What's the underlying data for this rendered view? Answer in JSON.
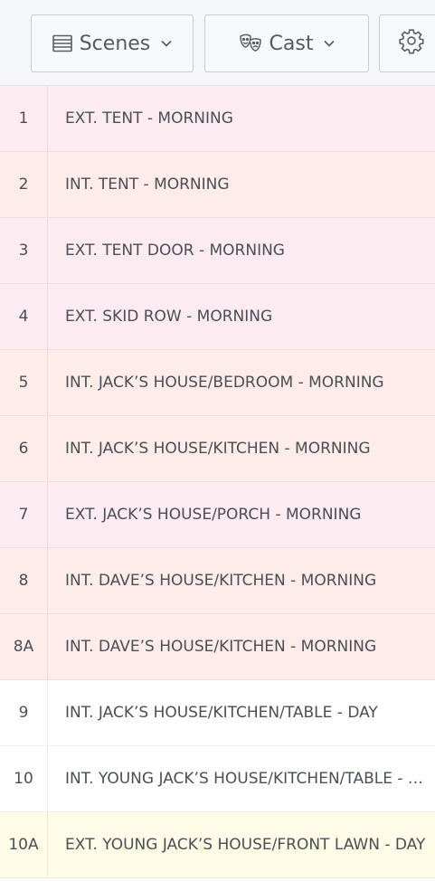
{
  "toolbar": {
    "scenes_label": "Scenes",
    "cast_label": "Cast",
    "icons": {
      "scenes": "list-icon",
      "cast": "masks-icon",
      "settings": "gear-icon",
      "dropdown": "chevron-down-icon"
    }
  },
  "colors": {
    "ext_morning": "#fdebf2",
    "int_morning": "#fdecea",
    "day": "#ffffff",
    "ext_day": "#fefbe6"
  },
  "scenes": [
    {
      "number": "1",
      "heading": "EXT. TENT - MORNING",
      "tint": "ext_morning"
    },
    {
      "number": "2",
      "heading": "INT. TENT - MORNING",
      "tint": "int_morning"
    },
    {
      "number": "3",
      "heading": "EXT. TENT DOOR - MORNING",
      "tint": "ext_morning"
    },
    {
      "number": "4",
      "heading": "EXT. SKID ROW - MORNING",
      "tint": "ext_morning"
    },
    {
      "number": "5",
      "heading": "INT. JACK’S HOUSE/BEDROOM - MORNING",
      "tint": "int_morning"
    },
    {
      "number": "6",
      "heading": "INT. JACK’S HOUSE/KITCHEN - MORNING",
      "tint": "int_morning"
    },
    {
      "number": "7",
      "heading": "EXT. JACK’S HOUSE/PORCH - MORNING",
      "tint": "ext_morning"
    },
    {
      "number": "8",
      "heading": "INT. DAVE’S HOUSE/KITCHEN - MORNING",
      "tint": "int_morning"
    },
    {
      "number": "8A",
      "heading": "INT. DAVE’S HOUSE/KITCHEN - MORNING",
      "tint": "int_morning"
    },
    {
      "number": "9",
      "heading": "INT. JACK’S HOUSE/KITCHEN/TABLE - DAY",
      "tint": "day"
    },
    {
      "number": "10",
      "heading": "INT. YOUNG JACK’S HOUSE/KITCHEN/TABLE - DAY",
      "tint": "day"
    },
    {
      "number": "10A",
      "heading": "EXT. YOUNG JACK’S HOUSE/FRONT LAWN - DAY",
      "tint": "ext_day"
    }
  ]
}
